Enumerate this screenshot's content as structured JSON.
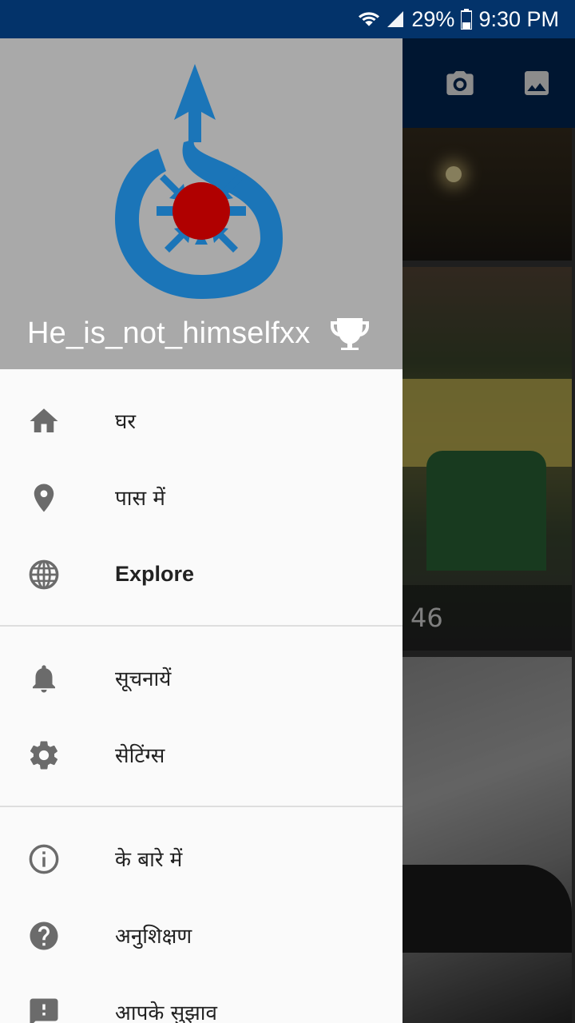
{
  "status_bar": {
    "battery": "29%",
    "time": "9:30 PM",
    "icons": [
      "wifi-icon",
      "signal-icon",
      "battery-icon"
    ]
  },
  "toolbar": {
    "icons": [
      "camera-icon",
      "gallery-icon"
    ]
  },
  "background": {
    "photo_caption": "46"
  },
  "drawer": {
    "username": "He_is_not_himselfxx",
    "logo": "wikimedia-commons-logo",
    "groups": [
      {
        "items": [
          {
            "icon": "home-icon",
            "label": "घर"
          },
          {
            "icon": "location-pin-icon",
            "label": "पास में"
          },
          {
            "icon": "globe-icon",
            "label": "Explore"
          }
        ]
      },
      {
        "items": [
          {
            "icon": "bell-icon",
            "label": "सूचनायें"
          },
          {
            "icon": "gear-icon",
            "label": "सेटिंग्स"
          }
        ]
      },
      {
        "items": [
          {
            "icon": "info-icon",
            "label": "के बारे में"
          },
          {
            "icon": "help-icon",
            "label": "अनुशिक्षण"
          },
          {
            "icon": "feedback-icon",
            "label": "आपके सुझाव"
          }
        ]
      }
    ]
  },
  "colors": {
    "status_bar": "#03336a",
    "toolbar": "#01285a",
    "drawer_header": "#a9a9a9",
    "logo_blue": "#1b75b8",
    "logo_red": "#b00000",
    "icon_grey": "#6b6b6b"
  }
}
